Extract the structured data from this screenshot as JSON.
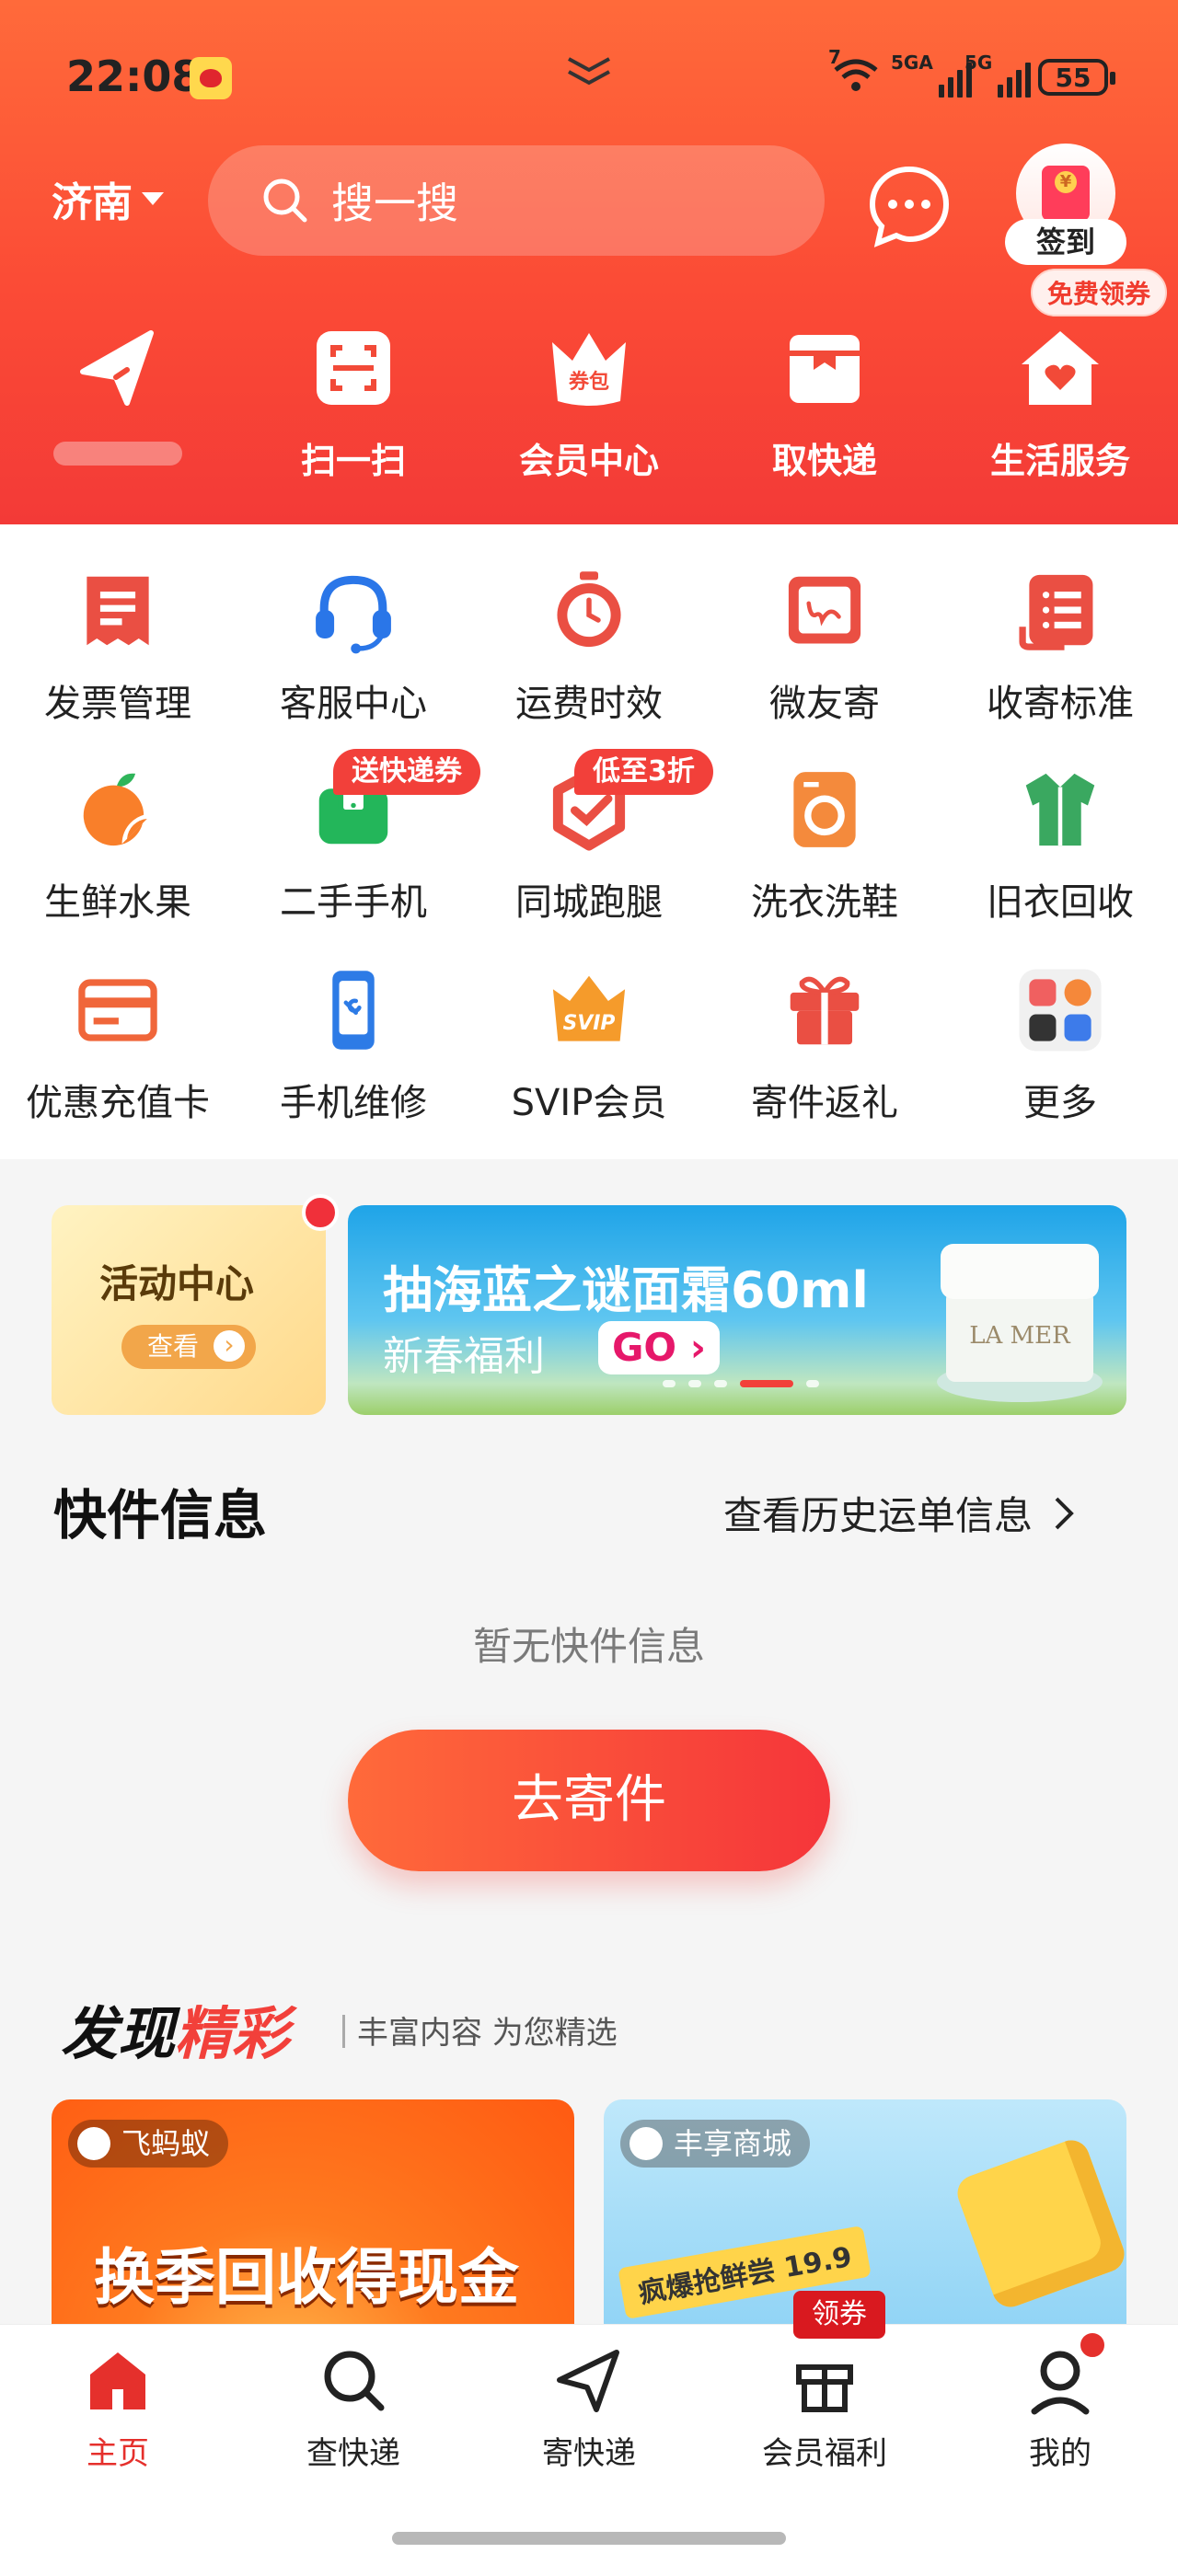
{
  "status_bar": {
    "time": "22:08",
    "signal1": "5GA",
    "signal2": "5G",
    "wifi_label": "7",
    "battery": "55"
  },
  "header": {
    "city": "济南",
    "search_placeholder": "搜一搜",
    "signin_label": "签到",
    "coupon_tag": "免费领券",
    "quick_actions": [
      {
        "label": "",
        "icon": "send-icon"
      },
      {
        "label": "扫一扫",
        "icon": "scan-icon"
      },
      {
        "label": "会员中心",
        "icon": "member-crown-icon"
      },
      {
        "label": "取快递",
        "icon": "package-pickup-icon"
      },
      {
        "label": "生活服务",
        "icon": "home-heart-icon"
      }
    ]
  },
  "services": [
    {
      "label": "发票管理",
      "icon": "invoice-icon"
    },
    {
      "label": "客服中心",
      "icon": "headset-icon"
    },
    {
      "label": "运费时效",
      "icon": "stopwatch-icon"
    },
    {
      "label": "微友寄",
      "icon": "signature-card-icon"
    },
    {
      "label": "收寄标准",
      "icon": "list-card-icon"
    },
    {
      "label": "生鲜水果",
      "icon": "orange-icon"
    },
    {
      "label": "二手手机",
      "icon": "bag-phone-icon",
      "badge": "送快递券"
    },
    {
      "label": "同城跑腿",
      "icon": "hexagon-check-icon",
      "badge": "低至3折"
    },
    {
      "label": "洗衣洗鞋",
      "icon": "washer-icon"
    },
    {
      "label": "旧衣回收",
      "icon": "shirt-icon"
    },
    {
      "label": "优惠充值卡",
      "icon": "credit-card-icon"
    },
    {
      "label": "手机维修",
      "icon": "phone-repair-icon"
    },
    {
      "label": "SVIP会员",
      "icon": "svip-crown-icon"
    },
    {
      "label": "寄件返礼",
      "icon": "gift-icon"
    },
    {
      "label": "更多",
      "icon": "more-grid-icon"
    }
  ],
  "activity": {
    "title": "活动中心",
    "button": "查看",
    "banner_title": "抽海蓝之谜面霜60ml",
    "banner_sub": "新春福利",
    "banner_go": "GO",
    "jar_brand": "LA MER"
  },
  "express": {
    "title": "快件信息",
    "history_link": "查看历史运单信息",
    "empty_text": "暂无快件信息",
    "send_button": "去寄件"
  },
  "discover": {
    "title_a": "发现",
    "title_b": "精彩",
    "subtitle": "丰富内容 为您精选",
    "cards": [
      {
        "source": "飞蚂蚁",
        "headline": "换季回收得现金"
      },
      {
        "source": "丰享商城",
        "headline": "疯爆抢鲜尝",
        "price": "19.9"
      }
    ]
  },
  "nav": {
    "items": [
      {
        "label": "主页",
        "icon": "home-icon",
        "active": true
      },
      {
        "label": "查快递",
        "icon": "search-icon"
      },
      {
        "label": "寄快递",
        "icon": "send-icon"
      },
      {
        "label": "会员福利",
        "icon": "gift-box-icon"
      },
      {
        "label": "我的",
        "icon": "user-icon"
      }
    ],
    "coupon_badge": "领券"
  },
  "colors": {
    "brand_red": "#f2403a",
    "header_top": "#ff6a3a",
    "text_dark": "#222222"
  }
}
